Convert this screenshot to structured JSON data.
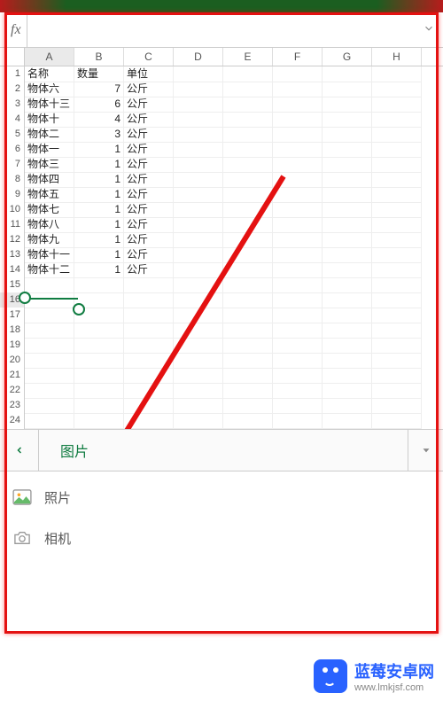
{
  "formula_bar": {
    "fx": "fx",
    "value": ""
  },
  "columns": [
    "A",
    "B",
    "C",
    "D",
    "E",
    "F",
    "G",
    "H"
  ],
  "selected_column": "A",
  "selected_row": 16,
  "headers": {
    "name": "名称",
    "qty": "数量",
    "unit": "单位"
  },
  "rows": [
    {
      "name": "物体六",
      "qty": 7,
      "unit": "公斤"
    },
    {
      "name": "物体十三",
      "qty": 6,
      "unit": "公斤"
    },
    {
      "name": "物体十",
      "qty": 4,
      "unit": "公斤"
    },
    {
      "name": "物体二",
      "qty": 3,
      "unit": "公斤"
    },
    {
      "name": "物体一",
      "qty": 1,
      "unit": "公斤"
    },
    {
      "name": "物体三",
      "qty": 1,
      "unit": "公斤"
    },
    {
      "name": "物体四",
      "qty": 1,
      "unit": "公斤"
    },
    {
      "name": "物体五",
      "qty": 1,
      "unit": "公斤"
    },
    {
      "name": "物体七",
      "qty": 1,
      "unit": "公斤"
    },
    {
      "name": "物体八",
      "qty": 1,
      "unit": "公斤"
    },
    {
      "name": "物体九",
      "qty": 1,
      "unit": "公斤"
    },
    {
      "name": "物体十一",
      "qty": 1,
      "unit": "公斤"
    },
    {
      "name": "物体十二",
      "qty": 1,
      "unit": "公斤"
    }
  ],
  "visible_row_count": 26,
  "panel": {
    "title": "图片",
    "options": [
      {
        "id": "photos",
        "label": "照片",
        "icon": "photo-icon"
      },
      {
        "id": "camera",
        "label": "相机",
        "icon": "camera-icon"
      }
    ]
  },
  "watermark": {
    "name": "蓝莓安卓网",
    "url": "www.lmkjsf.com"
  },
  "colors": {
    "accent": "#107c41",
    "annotation": "#e41111",
    "brand": "#2962ff"
  }
}
